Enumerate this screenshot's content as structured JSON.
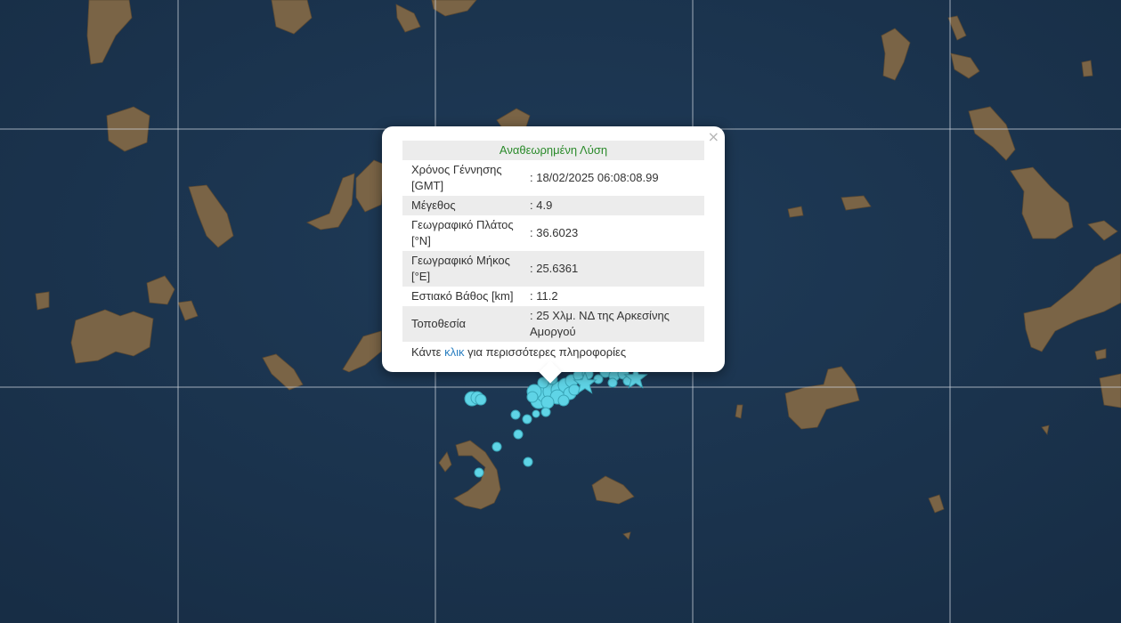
{
  "popup": {
    "close_label": "×",
    "title": "Αναθεωρημένη Λύση",
    "rows": [
      {
        "label": "Χρόνος Γέννησης [GMT]",
        "value": ": 18/02/2025 06:08:08.99"
      },
      {
        "label": "Μέγεθος",
        "value": ": 4.9"
      },
      {
        "label": "Γεωγραφικό Πλάτος [°N]",
        "value": ": 36.6023"
      },
      {
        "label": "Γεωγραφικό Μήκος [°E]",
        "value": ": 25.6361"
      },
      {
        "label": "Εστιακό Βάθος [km]",
        "value": ": 11.2"
      },
      {
        "label": "Τοποθεσία",
        "value": ": 25 Χλμ. ΝΔ της Αρκεσίνης Αμοργού"
      }
    ],
    "more_prefix": "Κάντε",
    "more_link": "κλικ",
    "more_suffix": "για περισσότερες πληροφορίες"
  },
  "colors": {
    "sea": "#1b3550",
    "land": "#7a6446",
    "marker": "#5fd4e6",
    "title": "#2a8a2a",
    "link": "#2a7fc1"
  },
  "icons": {
    "earthquake_marker": "circle",
    "strong_event_marker": "star"
  }
}
